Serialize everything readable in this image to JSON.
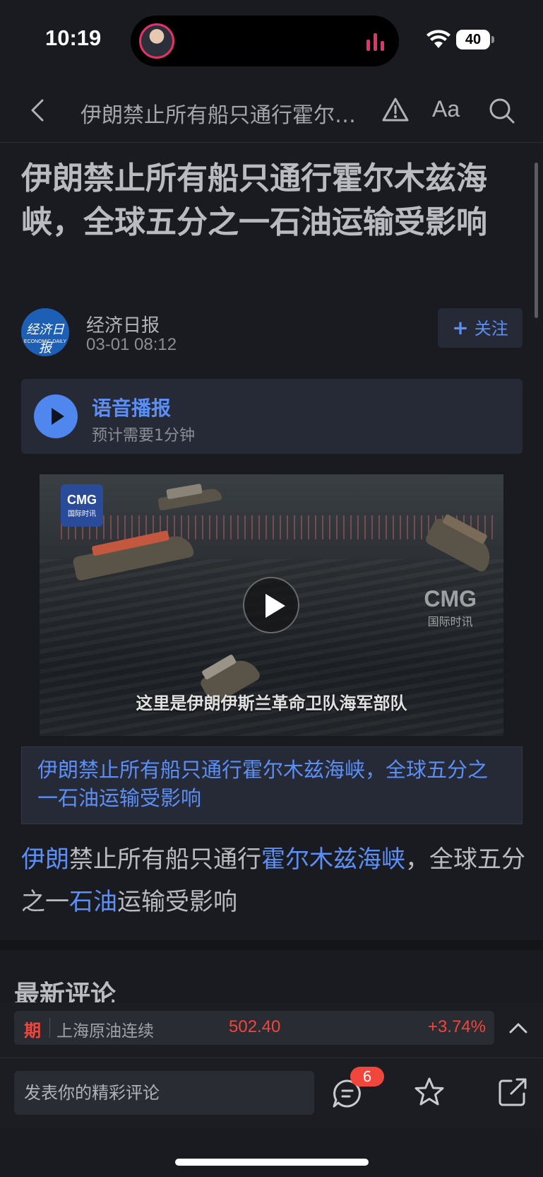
{
  "status_bar": {
    "time": "10:19",
    "battery": "40"
  },
  "nav": {
    "title": "伊朗禁止所有船只通行霍尔木兹海峡，全球五分之一石油运输受影响",
    "font_label": "Aa"
  },
  "article": {
    "headline": "伊朗禁止所有船只通行霍尔木兹海峡，全球五分之一石油运输受影响",
    "source": {
      "name": "经济日报",
      "time": "03-01 08:12",
      "logo_text": "经济日报",
      "logo_sub": "ECONOMIC DAILY",
      "follow_label": "关注"
    },
    "audio": {
      "title": "语音播报",
      "subtitle": "预计需要1分钟"
    },
    "video": {
      "badge_main": "CMG",
      "badge_sub": "国际时讯",
      "watermark_main": "CMG",
      "watermark_sub": "国际时讯",
      "caption": "这里是伊朗伊斯兰革命卫队海军部队"
    },
    "caption_box": "伊朗禁止所有船只通行霍尔木兹海峡，全球五分之一石油运输受影响",
    "body": {
      "p1_link1": "伊朗",
      "p1_text1": "禁止所有船只通行",
      "p1_link2": "霍尔木兹海峡",
      "p1_text2": "，全球五分之一",
      "p1_link3": "石油",
      "p1_text3": "运输受影响"
    }
  },
  "comments": {
    "title": "最新评论"
  },
  "ticker": {
    "badge": "期",
    "name": "上海原油连续",
    "price": "502.40",
    "change": "+3.74%"
  },
  "comment_bar": {
    "placeholder": "发表你的精彩评论",
    "count": "6"
  },
  "colors": {
    "accent": "#5b8ff5",
    "up": "#f0463c",
    "background": "#1a1b20",
    "card": "#262a36"
  }
}
